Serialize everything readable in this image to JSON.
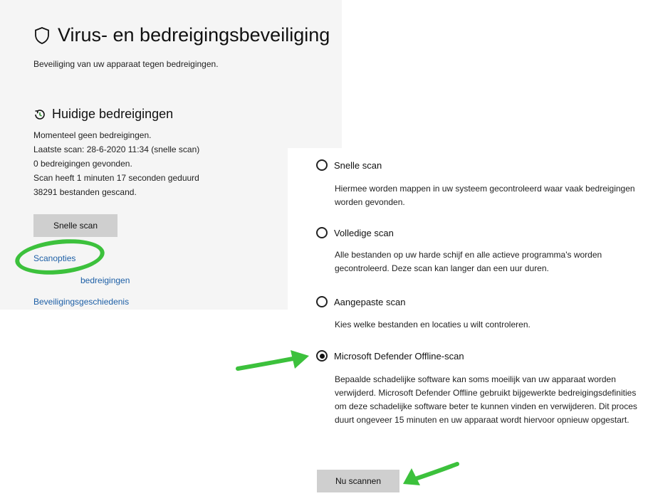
{
  "header": {
    "title": "Virus- en bedreigingsbeveiliging",
    "subtitle": "Beveiliging van uw apparaat tegen bedreigingen."
  },
  "current_threats": {
    "title": "Huidige bedreigingen",
    "lines": [
      "Momenteel geen bedreigingen.",
      "Laatste scan: 28-6-2020 11:34 (snelle scan)",
      "0 bedreigingen gevonden.",
      "Scan heeft 1 minuten 17 seconden geduurd",
      "38291 bestanden gescand."
    ],
    "quick_scan_button": "Snelle scan",
    "links": {
      "scan_options": "Scanopties",
      "allowed_threats_partial": "bedreigingen",
      "protection_history": "Beveiligingsgeschiedenis"
    }
  },
  "scan_options": [
    {
      "label": "Snelle scan",
      "checked": false,
      "description": "Hiermee worden mappen in uw systeem gecontroleerd waar vaak bedreigingen worden gevonden."
    },
    {
      "label": "Volledige scan",
      "checked": false,
      "description": "Alle bestanden op uw harde schijf en alle actieve programma's worden gecontroleerd. Deze scan kan langer dan een uur duren."
    },
    {
      "label": "Aangepaste scan",
      "checked": false,
      "description": "Kies welke bestanden en locaties u wilt controleren."
    },
    {
      "label": "Microsoft Defender Offline-scan",
      "checked": true,
      "description": "Bepaalde schadelijke software kan soms moeilijk van uw apparaat worden verwijderd. Microsoft Defender Offline gebruikt bijgewerkte bedreigingsdefinities om deze schadelijke software beter te kunnen vinden en verwijderen. Dit proces duurt ongeveer 15 minuten en uw apparaat wordt hiervoor opnieuw opgestart."
    }
  ],
  "scan_now_button": "Nu scannen",
  "colors": {
    "accent_link": "#1d5fa6",
    "annotation_green": "#3cc13c",
    "button_gray": "#cfcfcf",
    "panel_gray": "#f5f5f5"
  },
  "icons": {
    "title_icon": "shield-icon",
    "section_icon": "refresh-clock-icon",
    "annotations": [
      "green-circle",
      "green-arrow-left",
      "green-arrow-right"
    ]
  }
}
